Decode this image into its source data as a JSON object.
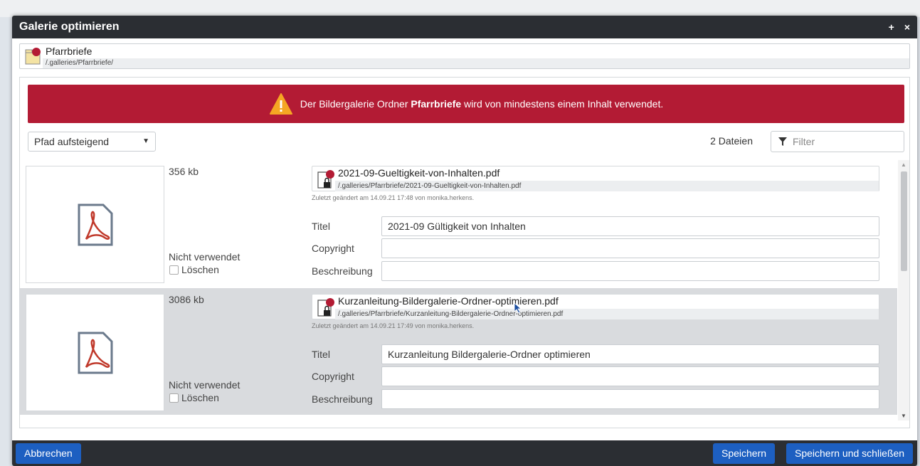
{
  "dialog": {
    "title": "Galerie optimieren",
    "controls": {
      "maximize": "+",
      "close": "×"
    }
  },
  "folder": {
    "name": "Pfarrbriefe",
    "path": "/.galleries/Pfarrbriefe/",
    "icon": "folder-gallery-icon"
  },
  "alert": {
    "prefix": "Der Bildergalerie Ordner ",
    "folder": "Pfarrbriefe",
    "suffix": " wird von mindestens einem Inhalt verwendet.",
    "color": "#b31b34",
    "icon": "warning-icon"
  },
  "toolbar": {
    "sort_value": "Pfad aufsteigend",
    "file_count": "2 Dateien",
    "filter_placeholder": "Filter"
  },
  "labels": {
    "title": "Titel",
    "copyright": "Copyright",
    "description": "Beschreibung",
    "unused": "Nicht verwendet",
    "delete": "Löschen"
  },
  "files": [
    {
      "size": "356 kb",
      "name": "2021-09-Gueltigkeit-von-Inhalten.pdf",
      "path": "/.galleries/Pfarrbriefe/2021-09-Gueltigkeit-von-Inhalten.pdf",
      "modified": "Zuletzt geändert am 14.09.21 17:48 von monika.herkens.",
      "title": "2021-09 Gültigkeit von Inhalten",
      "copyright": "",
      "description": ""
    },
    {
      "size": "3086 kb",
      "name": "Kurzanleitung-Bildergalerie-Ordner-optimieren.pdf",
      "path": "/.galleries/Pfarrbriefe/Kurzanleitung-Bildergalerie-Ordner-optimieren.pdf",
      "modified": "Zuletzt geändert am 14.09.21 17:49 von monika.herkens.",
      "title": "Kurzanleitung Bildergalerie-Ordner optimieren",
      "copyright": "",
      "description": ""
    }
  ],
  "footer": {
    "cancel": "Abbrechen",
    "save": "Speichern",
    "save_close": "Speichern und schließen",
    "button_color": "#1d5fc1"
  }
}
